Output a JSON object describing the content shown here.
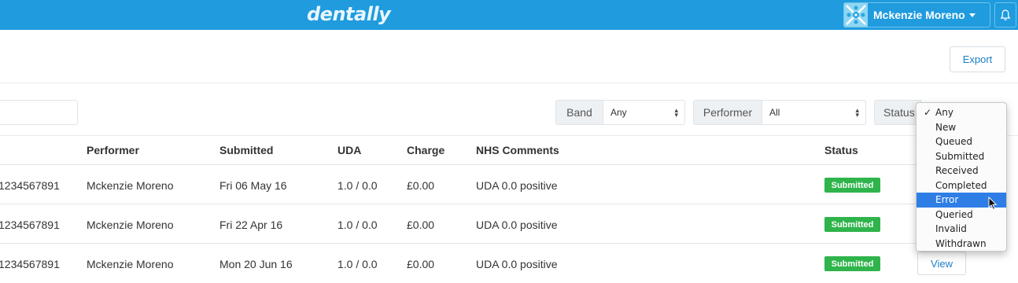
{
  "topbar": {
    "brand": "dentally",
    "user_name": "Mckenzie Moreno",
    "bg_color": "#1f9bde"
  },
  "header": {
    "export_label": "Export"
  },
  "filters": {
    "band_label": "Band",
    "band_value": "Any",
    "performer_label": "Performer",
    "performer_value": "All",
    "status_label": "Status"
  },
  "table": {
    "columns": [
      "Performer",
      "Submitted",
      "UDA",
      "Charge",
      "NHS Comments",
      "Status"
    ],
    "rows": [
      {
        "ref": "1234567891",
        "performer": "Mckenzie Moreno",
        "submitted": "Fri 06 May 16",
        "uda": "1.0 / 0.0",
        "charge": "£0.00",
        "comments": "UDA 0.0 positive",
        "status": "Submitted"
      },
      {
        "ref": "1234567891",
        "performer": "Mckenzie Moreno",
        "submitted": "Fri 22 Apr 16",
        "uda": "1.0 / 0.0",
        "charge": "£0.00",
        "comments": "UDA 0.0 positive",
        "status": "Submitted"
      },
      {
        "ref": "1234567891",
        "performer": "Mckenzie Moreno",
        "submitted": "Mon 20 Jun 16",
        "uda": "1.0 / 0.0",
        "charge": "£0.00",
        "comments": "UDA 0.0 positive",
        "status": "Submitted",
        "action": "View"
      }
    ],
    "status_color": "#2fb44c"
  },
  "status_dropdown": {
    "options": [
      "Any",
      "New",
      "Queued",
      "Submitted",
      "Received",
      "Completed",
      "Error",
      "Queried",
      "Invalid",
      "Withdrawn"
    ],
    "checked": "Any",
    "highlighted": "Error",
    "highlight_color": "#2f7ee6"
  }
}
